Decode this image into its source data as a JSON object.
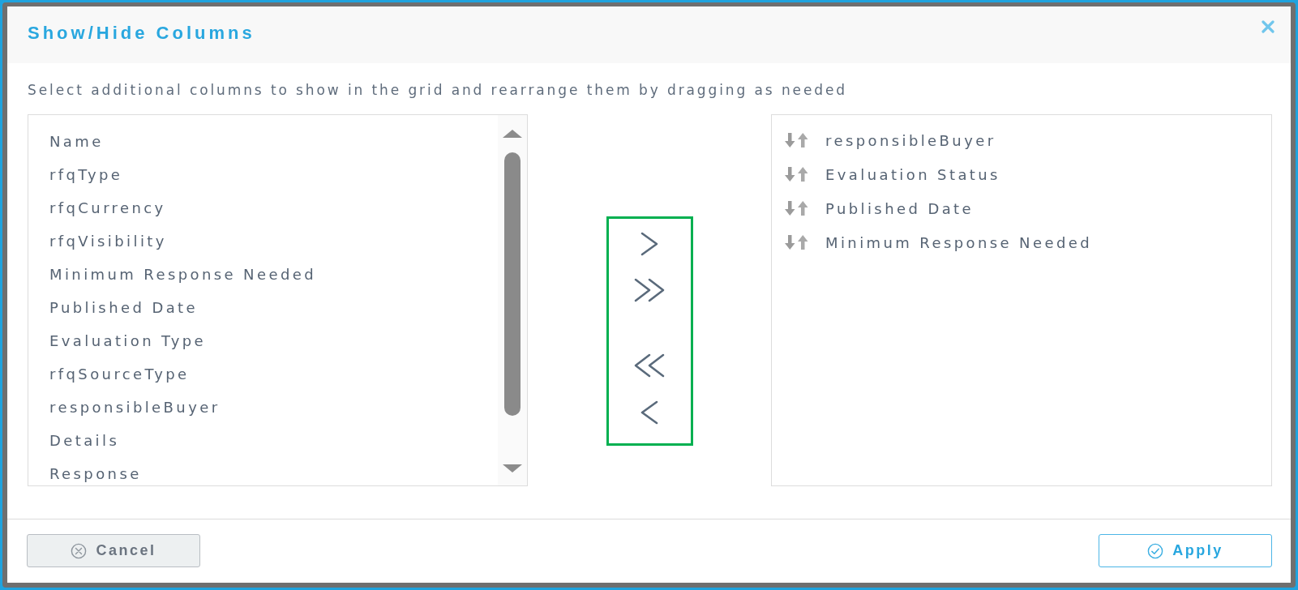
{
  "dialog": {
    "title": "Show/Hide Columns"
  },
  "instruction": "Select additional columns to show in the grid and rearrange them by dragging as needed",
  "available_columns": [
    "Name",
    "rfqType",
    "rfqCurrency",
    "rfqVisibility",
    "Minimum Response Needed",
    "Published Date",
    "Evaluation Type",
    "rfqSourceType",
    "responsibleBuyer",
    "Details",
    "Response"
  ],
  "transfer_controls": {
    "highlighted": true,
    "buttons": [
      {
        "kind": "move_one_right"
      },
      {
        "kind": "move_all_right"
      },
      {
        "kind": "move_all_left"
      },
      {
        "kind": "move_one_left"
      }
    ]
  },
  "selected_columns": [
    "responsibleBuyer",
    "Evaluation Status",
    "Published Date",
    "Minimum Response Needed"
  ],
  "footer": {
    "buttons": [
      {
        "label": "Cancel",
        "kind": "secondary"
      },
      {
        "label": "Apply",
        "kind": "primary"
      }
    ]
  }
}
